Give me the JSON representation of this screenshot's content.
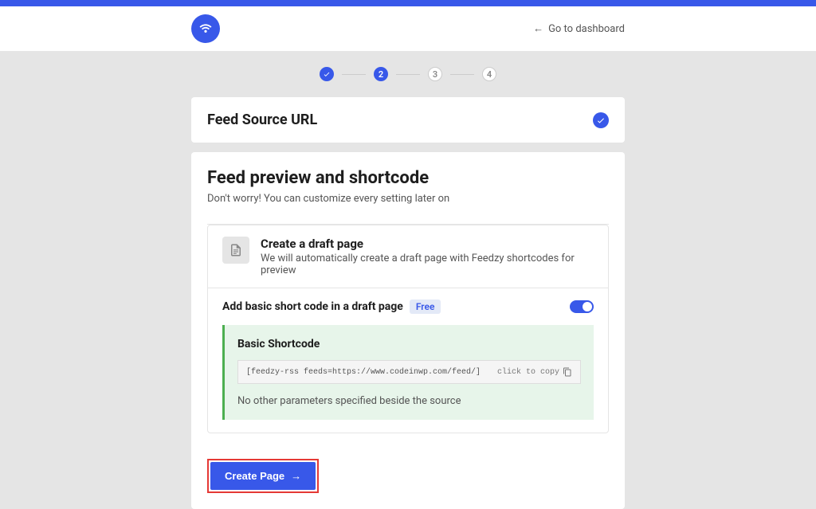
{
  "header": {
    "dashboard_link": "Go to dashboard"
  },
  "stepper": {
    "steps": [
      "✓",
      "2",
      "3",
      "4"
    ]
  },
  "card1": {
    "title": "Feed Source URL"
  },
  "main": {
    "title": "Feed preview and shortcode",
    "subtitle": "Don't worry! You can customize every setting later on",
    "draft": {
      "title": "Create a draft page",
      "desc": "We will automatically create a draft page with Feedzy shortcodes for preview"
    },
    "shortcode_row": {
      "label": "Add basic short code in a draft page",
      "badge": "Free"
    },
    "shortcode_box": {
      "title": "Basic Shortcode",
      "code": "[feedzy-rss feeds=https://www.codeinwp.com/feed/]",
      "copy_hint": "click to copy",
      "no_params": "No other parameters specified beside the source"
    },
    "create_button": "Create Page"
  }
}
